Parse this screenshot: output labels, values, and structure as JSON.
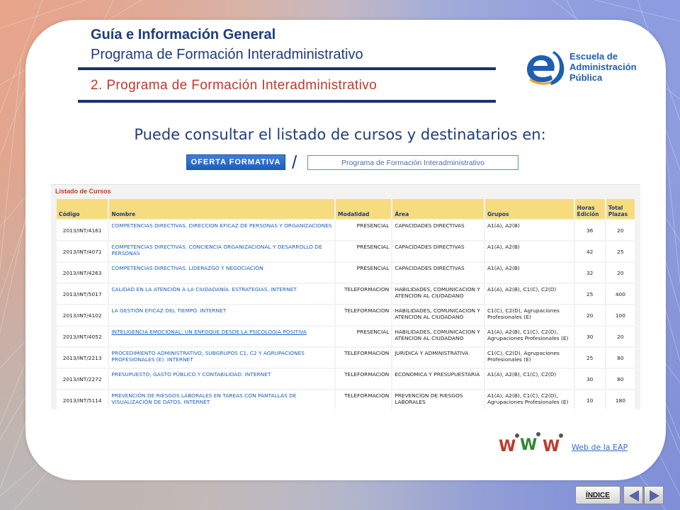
{
  "header": {
    "title_main": "Guía e Información General",
    "title_sub": "Programa de Formación Interadministrativo",
    "section_title": "2. Programa de Formación Interadministrativo"
  },
  "logo": {
    "line1": "Escuela de",
    "line2": "Administración",
    "line3": "Pública",
    "color": "#1f5fb0"
  },
  "intro": {
    "lead_text": "Puede consultar el listado de cursos y destinatarios en:",
    "oferta_button": "OFERTA FORMATIVA",
    "separator": "/",
    "programa_button": "Programa de Formación Interadministrativo"
  },
  "courses": {
    "heading": "Listado de Cursos",
    "columns": {
      "code": "Código",
      "name": "Nombre",
      "mod": "Modalidad",
      "area": "Área",
      "groups": "Grupos",
      "hours": "Horas Edición",
      "plazas": "Total Plazas"
    },
    "rows": [
      {
        "code": "2013/INT/4161",
        "name": "COMPETENCIAS DIRECTIVAS. DIRECCION EFICAZ DE PERSONAS Y ORGANIZACIONES",
        "mod": "PRESENCIAL",
        "area": "CAPACIDADES DIRECTIVAS",
        "groups": "A1(A), A2(B)",
        "hours": "36",
        "plazas": "20",
        "underline": false
      },
      {
        "code": "2013/INT/4071",
        "name": "COMPETENCIAS DIRECTIVAS. CONCIENCIA ORGANIZACIONAL Y DESARROLLO DE PERSONAS",
        "mod": "PRESENCIAL",
        "area": "CAPACIDADES DIRECTIVAS",
        "groups": "A1(A), A2(B)",
        "hours": "42",
        "plazas": "25",
        "underline": false
      },
      {
        "code": "2013/INT/4263",
        "name": "COMPETENCIAS DIRECTIVAS. LIDERAZGO Y NEGOCIACIÓN",
        "mod": "PRESENCIAL",
        "area": "CAPACIDADES DIRECTIVAS",
        "groups": "A1(A), A2(B)",
        "hours": "32",
        "plazas": "20",
        "underline": false
      },
      {
        "code": "2013/INT/5017",
        "name": "CALIDAD EN LA ATENCIÓN A LA CIUDADANÍA. ESTRATEGIAS. INTERNET",
        "mod": "TELEFORMACION",
        "area": "HABILIDADES, COMUNICACION Y ATENCION AL CIUDADANO",
        "groups": "A1(A), A2(B), C1(C), C2(D)",
        "hours": "25",
        "plazas": "400",
        "underline": false
      },
      {
        "code": "2013/INT/4102",
        "name": "LA GESTIÓN EFICAZ DEL TIEMPO. INTERNET",
        "mod": "TELEFORMACION",
        "area": "HABILIDADES, COMUNICACION Y ATENCION AL CIUDADANO",
        "groups": "C1(C), C2(D), Agrupaciones Profesionales (E)",
        "hours": "20",
        "plazas": "100",
        "underline": false
      },
      {
        "code": "2013/INT/4052",
        "name": "INTELIGENCIA EMOCIONAL: UN ENFOQUE DESDE LA PSICOLOGIA POSITIVA",
        "mod": "PRESENCIAL",
        "area": "HABILIDADES, COMUNICACION Y ATENCION AL CIUDADANO",
        "groups": "A1(A), A2(B), C1(C), C2(D), Agrupaciones Profesionales (E)",
        "hours": "30",
        "plazas": "20",
        "underline": true
      },
      {
        "code": "2013/INT/2213",
        "name": "PROCEDIMIENTO ADMINISTRATIVO, SUBGRUPOS C1, C2 Y AGRUPACIONES PROFESIONALES (E). INTERNET",
        "mod": "TELEFORMACION",
        "area": "JURIDICA Y ADMINISTRATIVA",
        "groups": "C1(C), C2(D), Agrupaciones Profesionales (E)",
        "hours": "25",
        "plazas": "80",
        "underline": false
      },
      {
        "code": "2013/INT/2272",
        "name": "PRESUPUESTO, GASTO PÚBLICO Y CONTABILIDAD. INTERNET",
        "mod": "TELEFORMACION",
        "area": "ECONOMICA Y PRESUPUESTARIA",
        "groups": "A1(A), A2(B), C1(C), C2(D)",
        "hours": "30",
        "plazas": "80",
        "underline": false
      },
      {
        "code": "2013/INT/5114",
        "name": "PREVENCIÓN DE RIESGOS LABORALES EN TAREAS CON PANTALLAS DE VISUALIZACIÓN DE DATOS. INTERNET",
        "mod": "TELEFORMACION",
        "area": "PREVENCION DE RIESGOS LABORALES",
        "groups": "A1(A), A2(B), C1(C), C2(D), Agrupaciones Profesionales (E)",
        "hours": "10",
        "plazas": "180",
        "underline": false
      }
    ]
  },
  "footer": {
    "www_icon": "www-icon",
    "web_link": "Web de la EAP",
    "indice_button": "ÍNDICE",
    "prev_icon": "arrow-left-icon",
    "next_icon": "arrow-right-icon"
  }
}
